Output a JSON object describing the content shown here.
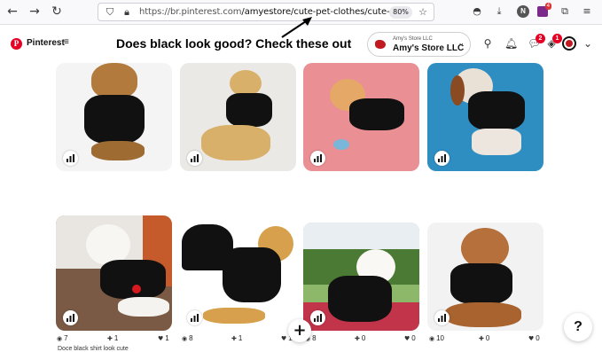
{
  "browser": {
    "url_host": "https://br.pinterest.com",
    "url_path": "/amyestore/cute-pet-clothes/cute-petd",
    "zoom": "80%",
    "ext_badge": "4"
  },
  "header": {
    "brand": "Pinterest",
    "menu_glyph": "≡",
    "annotation": "Does black look good? Check these out",
    "store_small": "Amy's Store LLC",
    "store_name": "Amy's Store LLC",
    "messages_badge": "2",
    "updates_badge": "1"
  },
  "colors": {
    "pinterest_red": "#e60023",
    "pin_bg_1": "#f3f3f3",
    "pin_bg_2": "#ebe9e6",
    "pin_bg_3": "#ea8f93",
    "pin_bg_4": "#2e8ec2"
  },
  "pins": [
    {
      "row": 1,
      "col": 1
    },
    {
      "row": 1,
      "col": 2
    },
    {
      "row": 1,
      "col": 3
    },
    {
      "row": 1,
      "col": 4
    },
    {
      "row": 2,
      "col": 1,
      "views": "7",
      "saves": "1",
      "reactions": "1"
    },
    {
      "row": 2,
      "col": 2,
      "views": "8",
      "saves": "1",
      "reactions": "1"
    },
    {
      "row": 2,
      "col": 3,
      "views": "8",
      "saves": "0",
      "reactions": "0"
    },
    {
      "row": 2,
      "col": 4,
      "views": "10",
      "saves": "0",
      "reactions": "0"
    }
  ],
  "pin_title": "Doce black shirt look cute",
  "fab": {
    "plus": "+",
    "help": "?"
  }
}
